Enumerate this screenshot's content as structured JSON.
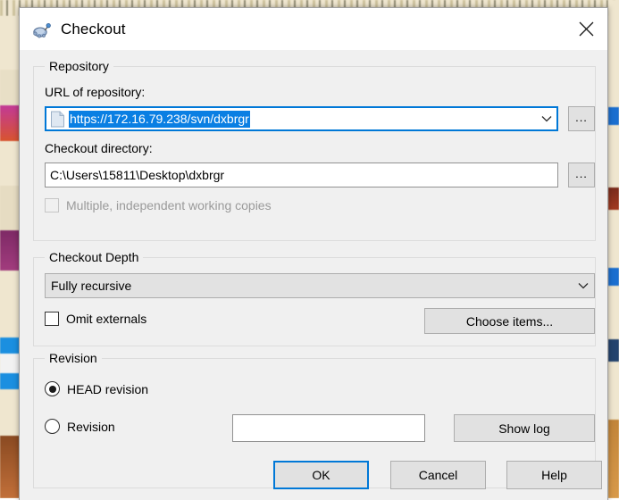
{
  "window": {
    "title": "Checkout",
    "icon": "tortoisesvn-checkout-icon",
    "close_label": "✕"
  },
  "repository": {
    "group_title": "Repository",
    "url_label": "URL of repository:",
    "url_value": "https://172.16.79.238/svn/dxbrgr",
    "url_browse_label": "...",
    "dir_label": "Checkout directory:",
    "dir_value": "C:\\Users\\15811\\Desktop\\dxbrgr",
    "dir_browse_label": "...",
    "multiple_copies_label": "Multiple, independent working copies",
    "multiple_copies_checked": false,
    "multiple_copies_enabled": false
  },
  "checkout_depth": {
    "group_title": "Checkout Depth",
    "depth_value": "Fully recursive",
    "omit_externals_label": "Omit externals",
    "omit_externals_checked": false,
    "choose_items_label": "Choose items..."
  },
  "revision": {
    "group_title": "Revision",
    "head_label": "HEAD revision",
    "head_selected": true,
    "revision_label": "Revision",
    "revision_selected": false,
    "revision_value": "",
    "show_log_label": "Show log"
  },
  "footer": {
    "ok_label": "OK",
    "cancel_label": "Cancel",
    "help_label": "Help"
  },
  "colors": {
    "accent": "#0078d7",
    "selection": "#0a7fe3",
    "dialog_bg": "#f0f0f0",
    "button_bg": "#e1e1e1"
  }
}
